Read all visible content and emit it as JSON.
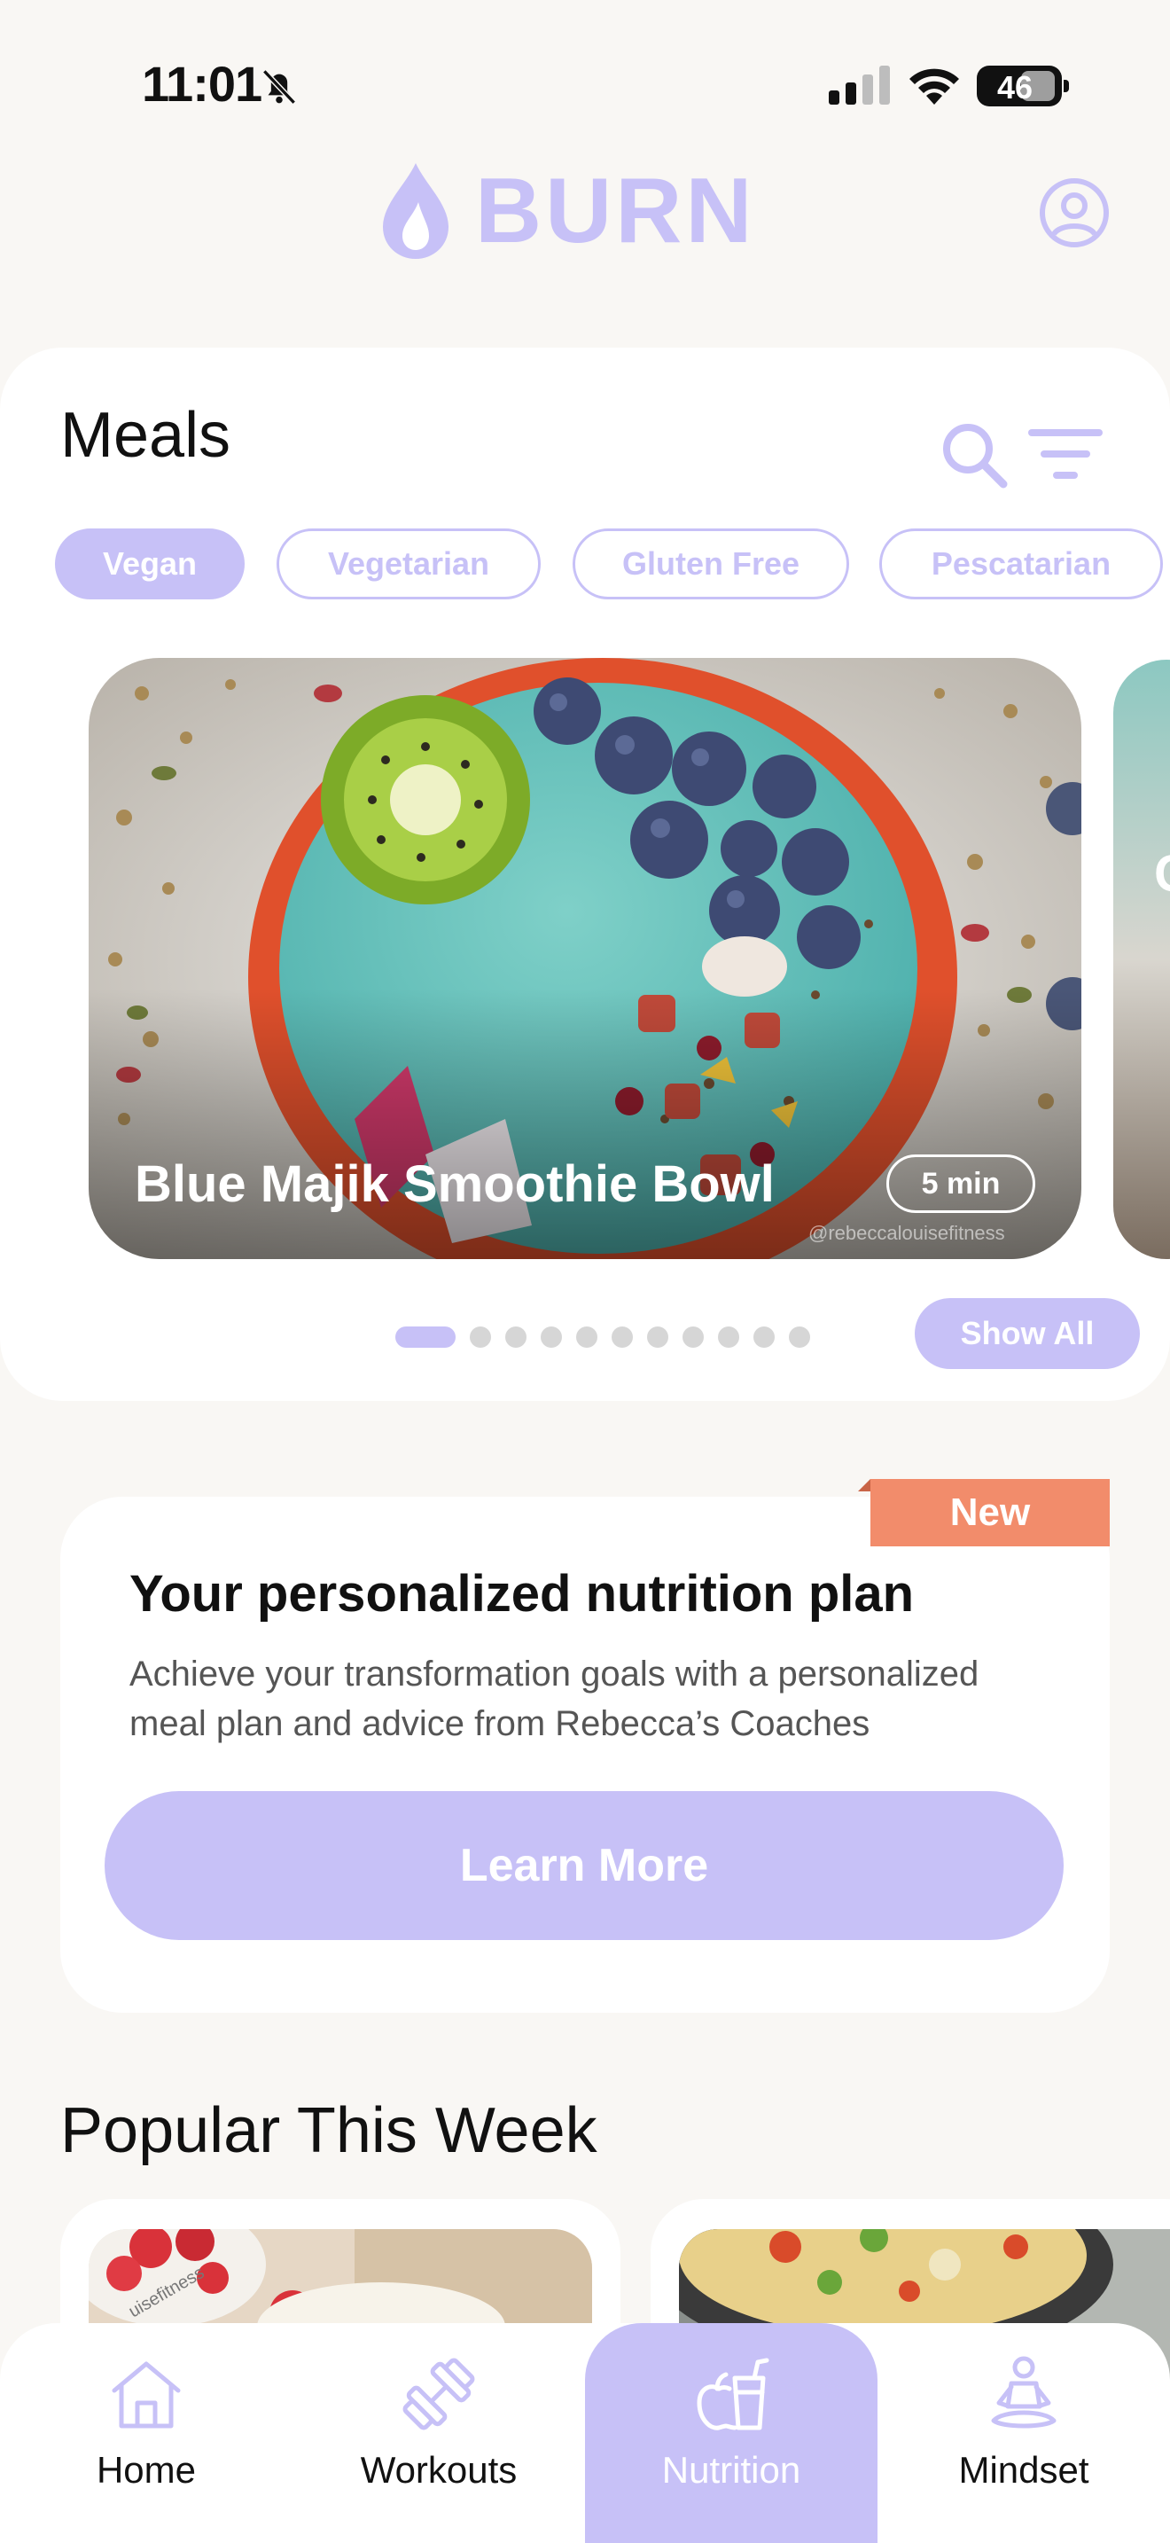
{
  "status_bar": {
    "time": "11:01",
    "battery": "46"
  },
  "header": {
    "brand": "BURN"
  },
  "meals": {
    "title": "Meals",
    "filters": [
      {
        "label": "Vegan",
        "active": true
      },
      {
        "label": "Vegetarian",
        "active": false
      },
      {
        "label": "Gluten Free",
        "active": false
      },
      {
        "label": "Pescatarian",
        "active": false
      }
    ],
    "featured": {
      "name": "Blue Majik Smoothie Bowl",
      "time": "5 min",
      "credit": "@rebeccalouisefitness"
    },
    "next_peek": "C",
    "carousel": {
      "count": 11,
      "active_index": 0
    },
    "show_all": "Show All"
  },
  "promo": {
    "badge": "New",
    "title": "Your personalized nutrition plan",
    "description": "Achieve your transformation goals with a personalized meal plan and advice from Rebecca’s Coaches",
    "cta": "Learn More"
  },
  "popular": {
    "title": "Popular This Week",
    "credit": "uisefitness"
  },
  "tab_bar": {
    "items": [
      {
        "label": "Home",
        "icon": "home-icon"
      },
      {
        "label": "Workouts",
        "icon": "dumbbell-icon"
      },
      {
        "label": "Nutrition",
        "icon": "apple-drink-icon",
        "active": true
      },
      {
        "label": "Mindset",
        "icon": "meditation-icon"
      }
    ]
  },
  "colors": {
    "accent": "#c7c1f7",
    "badge": "#f28c6b",
    "background": "#f9f7f4"
  }
}
